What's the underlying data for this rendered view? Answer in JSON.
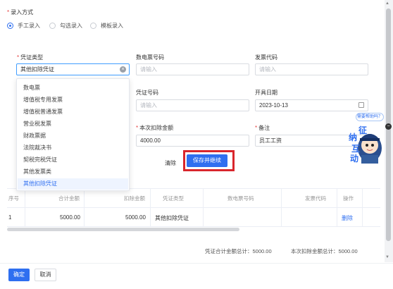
{
  "entry_mode": {
    "label": "录入方式",
    "options": [
      {
        "label": "手工录入",
        "selected": true
      },
      {
        "label": "勾选录入",
        "selected": false
      },
      {
        "label": "模板录入",
        "selected": false
      }
    ]
  },
  "form": {
    "voucher_type": {
      "label": "凭证类型",
      "value": "其他扣除凭证"
    },
    "digital_invoice_no": {
      "label": "数电票号码",
      "placeholder": "请输入"
    },
    "invoice_code": {
      "label": "发票代码",
      "placeholder": "请输入"
    },
    "voucher_no": {
      "label": "凭证号码",
      "placeholder": "请输入"
    },
    "issue_date": {
      "label": "开具日期",
      "value": "2023-10-13"
    },
    "deduct_amount": {
      "label": "本次扣除金额",
      "value": "4000.00"
    },
    "remark": {
      "label": "备注",
      "value": "员工工资"
    }
  },
  "dropdown": {
    "items": [
      "数电票",
      "增值税专用发票",
      "增值税普通发票",
      "营业税发票",
      "财政票据",
      "法院裁决书",
      "契税完税凭证",
      "其他发票类",
      "其他扣除凭证"
    ],
    "selected_index": 8
  },
  "buttons": {
    "clear": "清除",
    "save_continue": "保存并继续",
    "confirm": "确定",
    "cancel": "取消"
  },
  "table": {
    "headers": [
      "序号",
      "合计金额",
      "扣除金额",
      "凭证类型",
      "数电票号码",
      "发票代码",
      "操作"
    ],
    "rows": [
      {
        "index": "1",
        "total": "5000.00",
        "deduct": "5000.00",
        "type": "其他扣除凭证",
        "digital_no": "",
        "code": "",
        "action": "删除"
      }
    ]
  },
  "summary": {
    "voucher_total": "凭证合计金额总计：5000.00",
    "deduct_total": "本次扣除金额总计：5000.00"
  },
  "assistant": {
    "bubble": "需要帮助吗？",
    "text": [
      "征",
      "纳",
      "互",
      "动"
    ]
  },
  "colors": {
    "primary": "#2f6ff0",
    "highlight_box": "#d9262c",
    "required": "#e64545"
  }
}
